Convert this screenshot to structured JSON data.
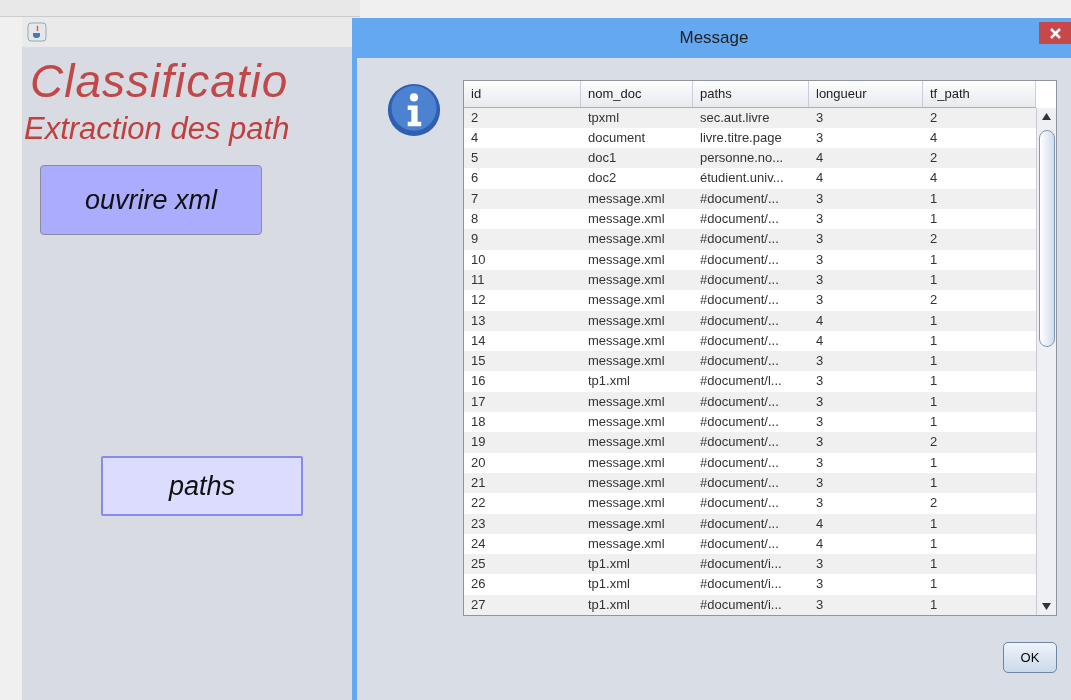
{
  "main_window": {
    "title": "Classificatio",
    "subtitle": "Extraction des path",
    "buttons": [
      {
        "label": "ouvrire xml",
        "kind": "primary"
      },
      {
        "label": "paths",
        "kind": "secondary"
      }
    ]
  },
  "dialog": {
    "title": "Message",
    "table": {
      "columns": [
        "id",
        "nom_doc",
        "paths",
        "longueur",
        "tf_path"
      ],
      "rows": [
        [
          "2",
          "tpxml",
          "sec.aut.livre",
          "3",
          "2"
        ],
        [
          "4",
          "document",
          "livre.titre.page",
          "3",
          "4"
        ],
        [
          "5",
          "doc1",
          "personne.no...",
          "4",
          "2"
        ],
        [
          "6",
          "doc2",
          "étudient.univ...",
          "4",
          "4"
        ],
        [
          "7",
          "message.xml",
          "#document/...",
          "3",
          "1"
        ],
        [
          "8",
          "message.xml",
          "#document/...",
          "3",
          "1"
        ],
        [
          "9",
          "message.xml",
          "#document/...",
          "3",
          "2"
        ],
        [
          "10",
          "message.xml",
          "#document/...",
          "3",
          "1"
        ],
        [
          "11",
          "message.xml",
          "#document/...",
          "3",
          "1"
        ],
        [
          "12",
          "message.xml",
          "#document/...",
          "3",
          "2"
        ],
        [
          "13",
          "message.xml",
          "#document/...",
          "4",
          "1"
        ],
        [
          "14",
          "message.xml",
          "#document/...",
          "4",
          "1"
        ],
        [
          "15",
          "message.xml",
          "#document/...",
          "3",
          "1"
        ],
        [
          "16",
          "tp1.xml",
          "#document/l...",
          "3",
          "1"
        ],
        [
          "17",
          "message.xml",
          "#document/...",
          "3",
          "1"
        ],
        [
          "18",
          "message.xml",
          "#document/...",
          "3",
          "1"
        ],
        [
          "19",
          "message.xml",
          "#document/...",
          "3",
          "2"
        ],
        [
          "20",
          "message.xml",
          "#document/...",
          "3",
          "1"
        ],
        [
          "21",
          "message.xml",
          "#document/...",
          "3",
          "1"
        ],
        [
          "22",
          "message.xml",
          "#document/...",
          "3",
          "2"
        ],
        [
          "23",
          "message.xml",
          "#document/...",
          "4",
          "1"
        ],
        [
          "24",
          "message.xml",
          "#document/...",
          "4",
          "1"
        ],
        [
          "25",
          "tp1.xml",
          "#document/i...",
          "3",
          "1"
        ],
        [
          "26",
          "tp1.xml",
          "#document/i...",
          "3",
          "1"
        ],
        [
          "27",
          "tp1.xml",
          "#document/i...",
          "3",
          "1"
        ]
      ]
    },
    "ok_button": "OK"
  }
}
